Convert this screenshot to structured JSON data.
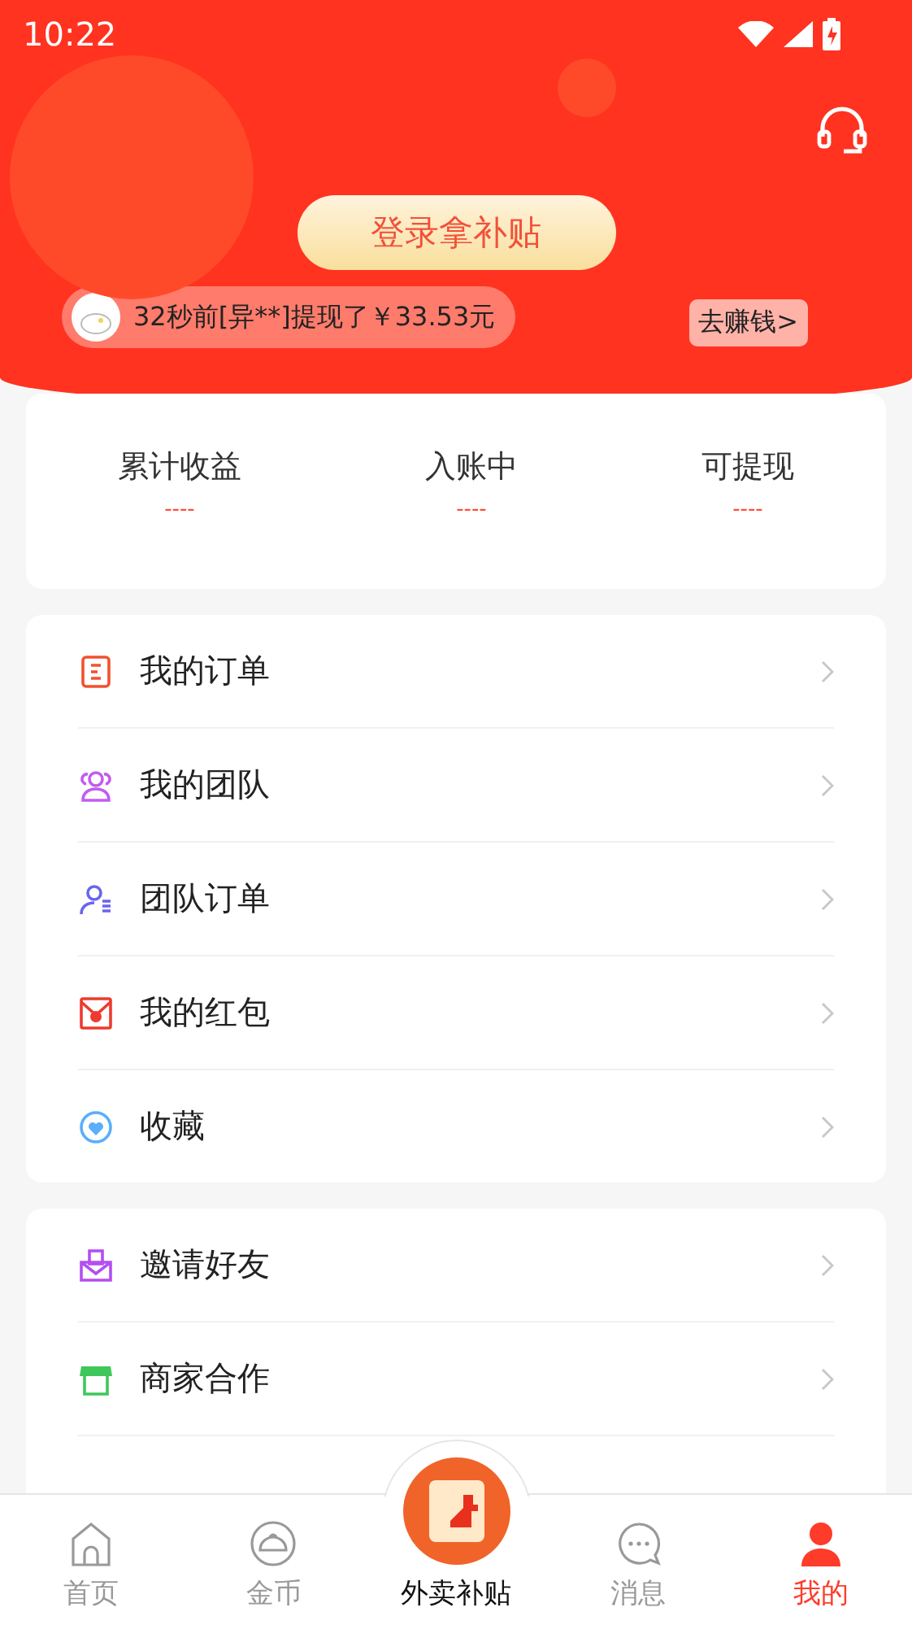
{
  "status_bar": {
    "time": "10:22"
  },
  "header": {
    "login_button": "登录拿补贴",
    "ticker": "32秒前[异**]提现了￥33.53元",
    "earn_tip": "去赚钱>"
  },
  "stats": [
    {
      "label": "累计收益",
      "value": "----"
    },
    {
      "label": "入账中",
      "value": "----"
    },
    {
      "label": "可提现",
      "value": "----"
    }
  ],
  "menu_groups": [
    {
      "items": [
        {
          "label": "我的订单",
          "color": "#f0522e"
        },
        {
          "label": "我的团队",
          "color": "#c25cf0"
        },
        {
          "label": "团队订单",
          "color": "#6a64f0"
        },
        {
          "label": "我的红包",
          "color": "#ee3a2e"
        },
        {
          "label": "收藏",
          "color": "#5aaefc"
        }
      ]
    },
    {
      "items": [
        {
          "label": "邀请好友",
          "color": "#b34ff0"
        },
        {
          "label": "商家合作",
          "color": "#3fc75a"
        }
      ]
    }
  ],
  "tab_bar": [
    {
      "label": "首页",
      "kind": "normal",
      "selected": false
    },
    {
      "label": "金币",
      "kind": "normal",
      "selected": false
    },
    {
      "label": "外卖补贴",
      "kind": "center",
      "selected": false
    },
    {
      "label": "消息",
      "kind": "normal",
      "selected": false
    },
    {
      "label": "我的",
      "kind": "normal",
      "selected": true
    }
  ]
}
